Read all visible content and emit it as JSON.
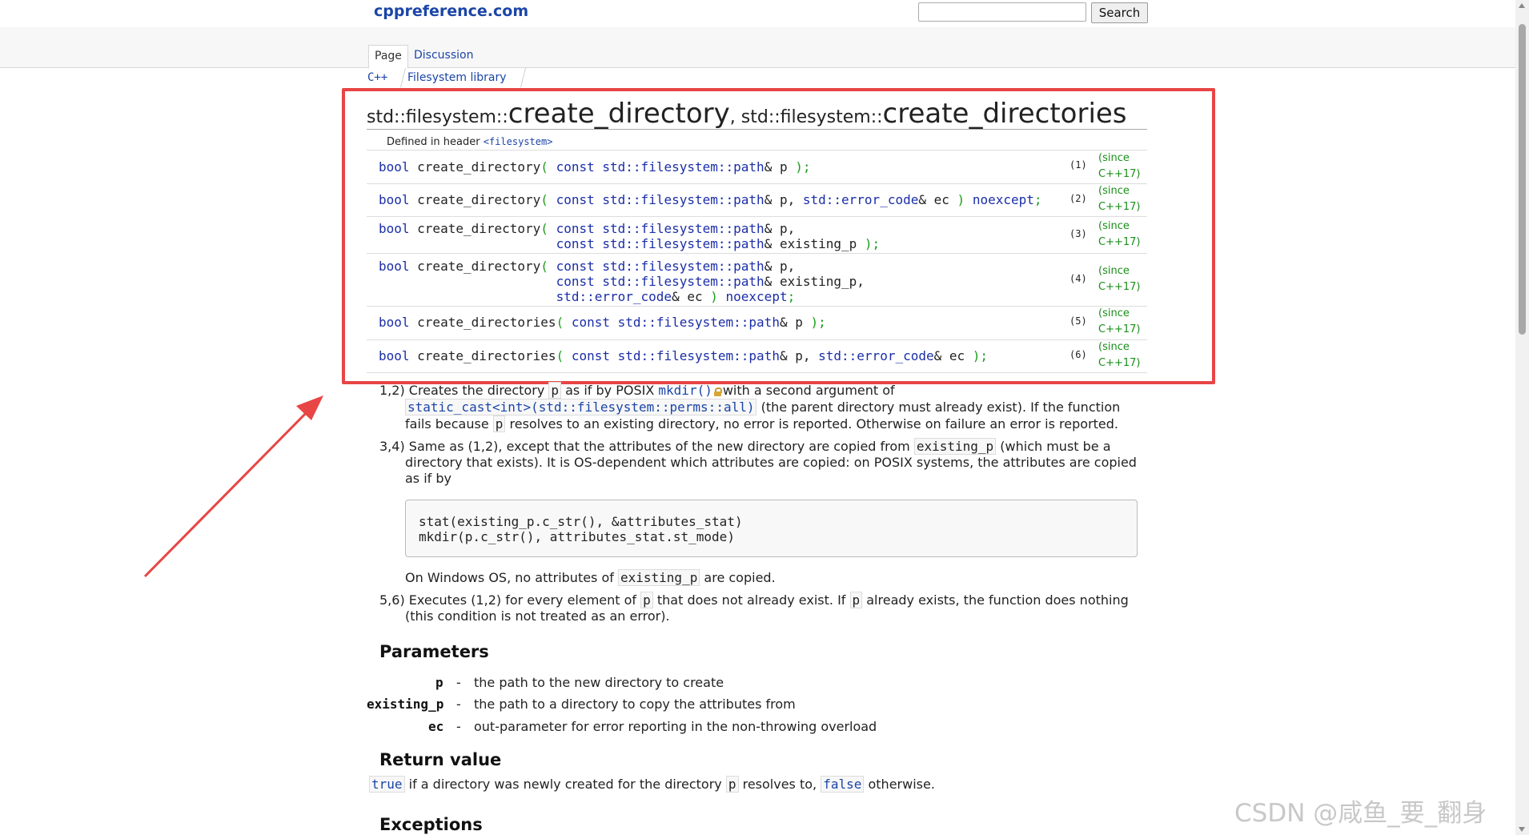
{
  "header": {
    "logo": "cppreference.com",
    "search_value": "",
    "search_button": "Search"
  },
  "tabs": [
    {
      "label": "Page"
    },
    {
      "label": "Discussion"
    }
  ],
  "breadcrumb": [
    "C++",
    "Filesystem library"
  ],
  "title": {
    "ns1": "std::filesystem::",
    "name1": "create_directory",
    "sep": ", ",
    "ns2": "std::filesystem::",
    "name2": "create_directories"
  },
  "defined_in": {
    "label": "Defined in header",
    "header": "<filesystem>"
  },
  "declarations": [
    {
      "num": "(1)",
      "since": "(since",
      "since2": "C++17)"
    },
    {
      "num": "(2)",
      "since": "(since",
      "since2": "C++17)"
    },
    {
      "num": "(3)",
      "since": "(since",
      "since2": "C++17)"
    },
    {
      "num": "(4)",
      "since": "(since",
      "since2": "C++17)"
    },
    {
      "num": "(5)",
      "since": "(since",
      "since2": "C++17)"
    },
    {
      "num": "(6)",
      "since": "(since",
      "since2": "C++17)"
    }
  ],
  "description": {
    "item12_label": "1,2)",
    "item12_a": "Creates the directory",
    "item12_p": "p",
    "item12_b": "as if by POSIX",
    "item12_mkdir": "mkdir()",
    "item12_c": "with a second argument of",
    "item12_cast": "static_cast<int>(std::filesystem::perms::all)",
    "item12_d": "(the parent directory must already exist). If the function",
    "item12_e": "fails because",
    "item12_f": "resolves to an existing directory, no error is reported. Otherwise on failure an error is reported.",
    "item34_label": "3,4)",
    "item34_a": "Same as (1,2), except that the attributes of the new directory are copied from",
    "item34_code": "existing_p",
    "item34_b": "(which must be a",
    "item34_c": "directory that exists). It is OS-dependent which attributes are copied: on POSIX systems, the attributes are copied",
    "item34_d": "as if by",
    "code_line1": "stat(existing_p.c_str(), &attributes_stat)",
    "code_line2": "mkdir(p.c_str(), attributes_stat.st_mode)",
    "windows_a": "On Windows OS, no attributes of",
    "windows_code": "existing_p",
    "windows_b": "are copied.",
    "item56_label": "5,6)",
    "item56_a": "Executes (1,2) for every element of",
    "item56_p": "p",
    "item56_b": "that does not already exist. If",
    "item56_c": "already exists, the function does nothing",
    "item56_d": "(this condition is not treated as an error)."
  },
  "parameters": {
    "heading": "Parameters",
    "items": [
      {
        "name": "p",
        "dash": "-",
        "desc": "the path to the new directory to create"
      },
      {
        "name": "existing_p",
        "dash": "-",
        "desc": "the path to a directory to copy the attributes from"
      },
      {
        "name": "ec",
        "dash": "-",
        "desc": "out-parameter for error reporting in the non-throwing overload"
      }
    ]
  },
  "return_value": {
    "heading": "Return value",
    "true": "true",
    "a": "if a directory was newly created for the directory",
    "p": "p",
    "b": "resolves to,",
    "false": "false",
    "c": "otherwise."
  },
  "exceptions": {
    "heading": "Exceptions"
  },
  "watermark": "CSDN @咸鱼_要_翻身",
  "colors": {
    "highlight": "#e84545",
    "link": "#1b45a7",
    "since": "#1a8e1a"
  }
}
